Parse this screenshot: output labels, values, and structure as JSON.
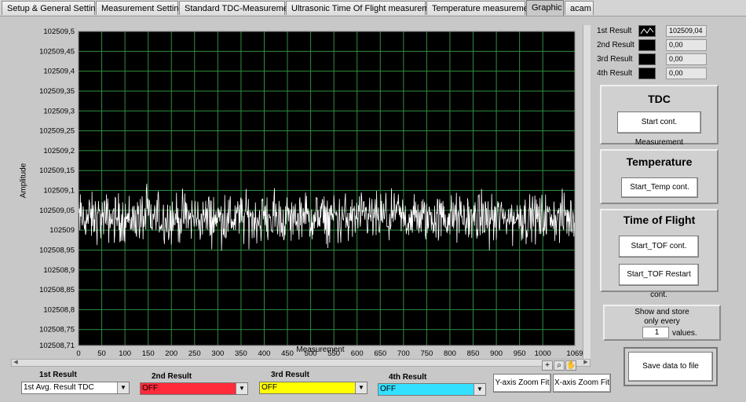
{
  "tabs": [
    {
      "label": "Setup & General Settings",
      "active": false
    },
    {
      "label": "Measurement Settings",
      "active": false
    },
    {
      "label": "Standard TDC-Measurement",
      "active": false
    },
    {
      "label": "Ultrasonic Time Of Flight measurement",
      "active": false
    },
    {
      "label": "Temperature measurement",
      "active": false
    },
    {
      "label": "Graphic",
      "active": true
    },
    {
      "label": "acam",
      "active": false
    }
  ],
  "legend": [
    {
      "name": "1st Result",
      "value": "102509,04"
    },
    {
      "name": "2nd Result",
      "value": "0,00"
    },
    {
      "name": "3rd Result",
      "value": "0,00"
    },
    {
      "name": "4th Result",
      "value": "0,00"
    }
  ],
  "groups": {
    "tdc": {
      "title": "TDC",
      "button": "Start cont. Measurement"
    },
    "temperature": {
      "title": "Temperature",
      "button": "Start_Temp cont."
    },
    "tof": {
      "title": "Time of Flight",
      "button1": "Start_TOF cont.",
      "button2": "Start_TOF Restart cont."
    }
  },
  "store": {
    "line1": "Show and store",
    "line2": "only every",
    "value": "1",
    "suffix": "values."
  },
  "save_button": "Save data to file",
  "selectors": [
    {
      "label": "1st Result",
      "value": "1st Avg. Result TDC",
      "color": "#ffffff"
    },
    {
      "label": "2nd Result",
      "value": "OFF",
      "color": "#ff2a3a"
    },
    {
      "label": "3rd Result",
      "value": "OFF",
      "color": "#ffff00"
    },
    {
      "label": "4th Result",
      "value": "OFF",
      "color": "#33e0ff"
    }
  ],
  "zoom": {
    "y": "Y-axis Zoom Fit",
    "x": "X-axis Zoom Fit"
  },
  "colors": {
    "plot_bg": "#000000",
    "grid": "#2f8f3f",
    "trace": "#ffffff"
  },
  "chart_data": {
    "type": "line",
    "title": "",
    "xlabel": "Measurement",
    "ylabel": "Amplitude",
    "xlim": [
      0,
      1069
    ],
    "ylim": [
      102508.71,
      102509.5
    ],
    "x_ticks": [
      "0",
      "50",
      "100",
      "150",
      "200",
      "250",
      "300",
      "350",
      "400",
      "450",
      "500",
      "550",
      "600",
      "650",
      "700",
      "750",
      "800",
      "850",
      "900",
      "950",
      "1000",
      "1069"
    ],
    "y_ticks": [
      "102509,5",
      "102509,45",
      "102509,4",
      "102509,35",
      "102509,3",
      "102509,25",
      "102509,2",
      "102509,15",
      "102509,1",
      "102509,05",
      "102509",
      "102508,95",
      "102508,9",
      "102508,85",
      "102508,8",
      "102508,75",
      "102508,71"
    ],
    "series": [
      {
        "points": 1070,
        "mean": 102509.03,
        "noise_min": 102508.95,
        "noise_max": 102509.13
      }
    ]
  }
}
